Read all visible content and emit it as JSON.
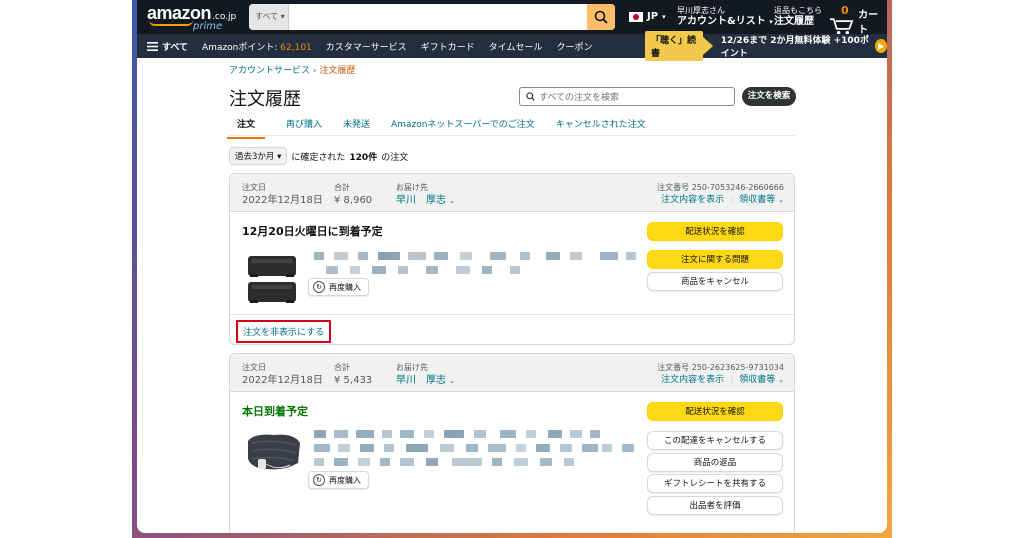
{
  "header": {
    "logo_main": "amazon",
    "logo_domain": ".co.jp",
    "logo_sub": "prime",
    "search_category": "すべて",
    "country": "JP",
    "account_greeting": "早川厚志さん",
    "account_label": "アカウント&リスト",
    "returns_line1": "返品もこちら",
    "returns_line2": "注文履歴",
    "cart_count": "0",
    "cart_label": "カート"
  },
  "nav": {
    "all": "すべて",
    "points_label": "Amazonポイント: ",
    "points_value": "62,101",
    "items": [
      "カスタマーサービス",
      "ギフトカード",
      "タイムセール",
      "クーポン"
    ],
    "banner_tag": "「聴く」読書",
    "banner_text": "12/26まで 2か月無料体験 +100ポイント"
  },
  "breadcrumb": {
    "parent": "アカウントサービス",
    "sep": "›",
    "current": "注文履歴"
  },
  "page": {
    "title": "注文履歴",
    "search_placeholder": "すべての注文を検索",
    "search_button": "注文を検索",
    "tabs": [
      "注文",
      "再び購入",
      "未発送",
      "Amazonネットスーパーでのご注文",
      "キャンセルされた注文"
    ],
    "period_select": "過去3か月",
    "period_text_pre": "に確定された",
    "period_count": "120件",
    "period_text_post": "の注文"
  },
  "labels": {
    "order_date": "注文日",
    "total": "合計",
    "ship_to": "お届け先",
    "order_number_prefix": "注文番号 ",
    "order_details": "注文内容を表示",
    "receipt": "領収書等",
    "rebuy": "再度購入"
  },
  "orders": [
    {
      "date": "2022年12月18日",
      "total": "¥ 8,960",
      "recipient": "早川　厚志",
      "order_number": "250-7053246-2660666",
      "delivery": "12月20日火曜日に到着予定",
      "buttons": [
        "配送状況を確認",
        "注文に関する問題",
        "商品をキャンセル"
      ],
      "hide_link": "注文を非表示にする"
    },
    {
      "date": "2022年12月18日",
      "total": "¥ 5,433",
      "recipient": "早川　厚志",
      "order_number": "250-2623625-9731034",
      "delivery": "本日到着予定",
      "buttons": [
        "配送状況を確認",
        "この配達をキャンセルする",
        "商品の返品",
        "ギフトレシートを共有する",
        "出品者を評価"
      ]
    }
  ],
  "colors": {
    "header_bg": "#131921",
    "nav_bg": "#232f3e",
    "accent_orange": "#f08804",
    "link": "#007185",
    "button_yellow": "#ffd814",
    "delivery_green": "#007600",
    "highlight_red": "#d0021b"
  }
}
